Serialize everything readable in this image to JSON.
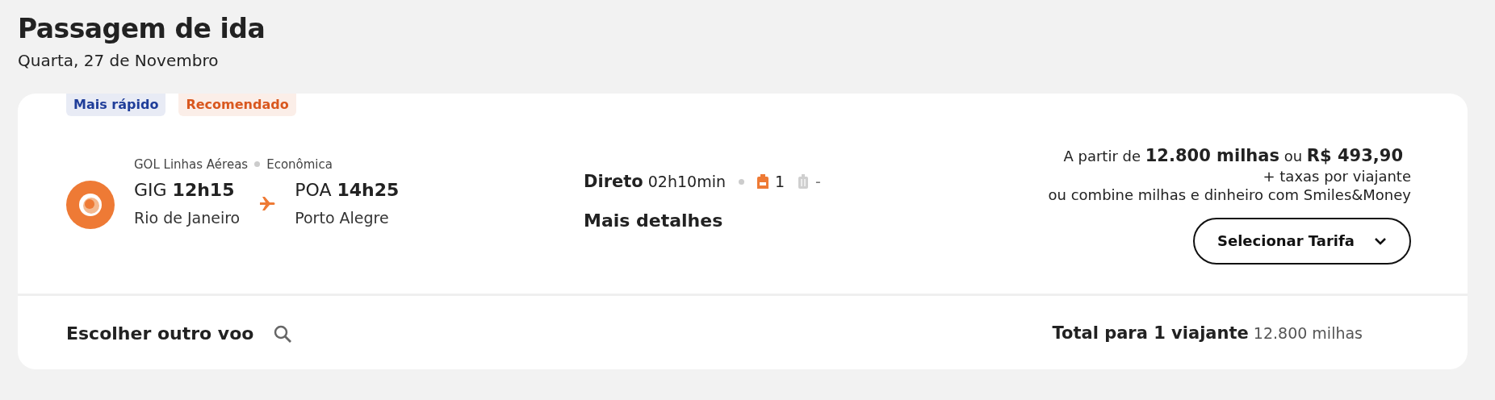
{
  "header": {
    "title": "Passagem de ida",
    "date": "Quarta, 27 de Novembro"
  },
  "badges": [
    {
      "label": "Mais rápido",
      "color": "#1f3d99"
    },
    {
      "label": "Recomendado",
      "color": "#d9581f"
    }
  ],
  "flight": {
    "airline": "GOL Linhas Aéreas",
    "cabin": "Econômica",
    "origin": {
      "code": "GIG",
      "time": "12h15",
      "city": "Rio de Janeiro"
    },
    "destination": {
      "code": "POA",
      "time": "14h25",
      "city": "Porto Alegre"
    },
    "stops": "Direto",
    "duration": "02h10min",
    "carry_on": {
      "included": true,
      "count": "1"
    },
    "checked_bag": {
      "included": false,
      "count": "-"
    },
    "details_link": "Mais detalhes"
  },
  "price": {
    "prefix": "A partir de",
    "miles": "12.800 milhas",
    "or": "ou",
    "cash": "R$ 493,90",
    "taxes": "+ taxas por viajante",
    "combine": "ou combine milhas e dinheiro com Smiles&Money",
    "button": "Selecionar Tarifa"
  },
  "footer": {
    "other_flight": "Escolher outro voo",
    "total_label": "Total para 1 viajante",
    "total_value": "12.800 milhas"
  }
}
